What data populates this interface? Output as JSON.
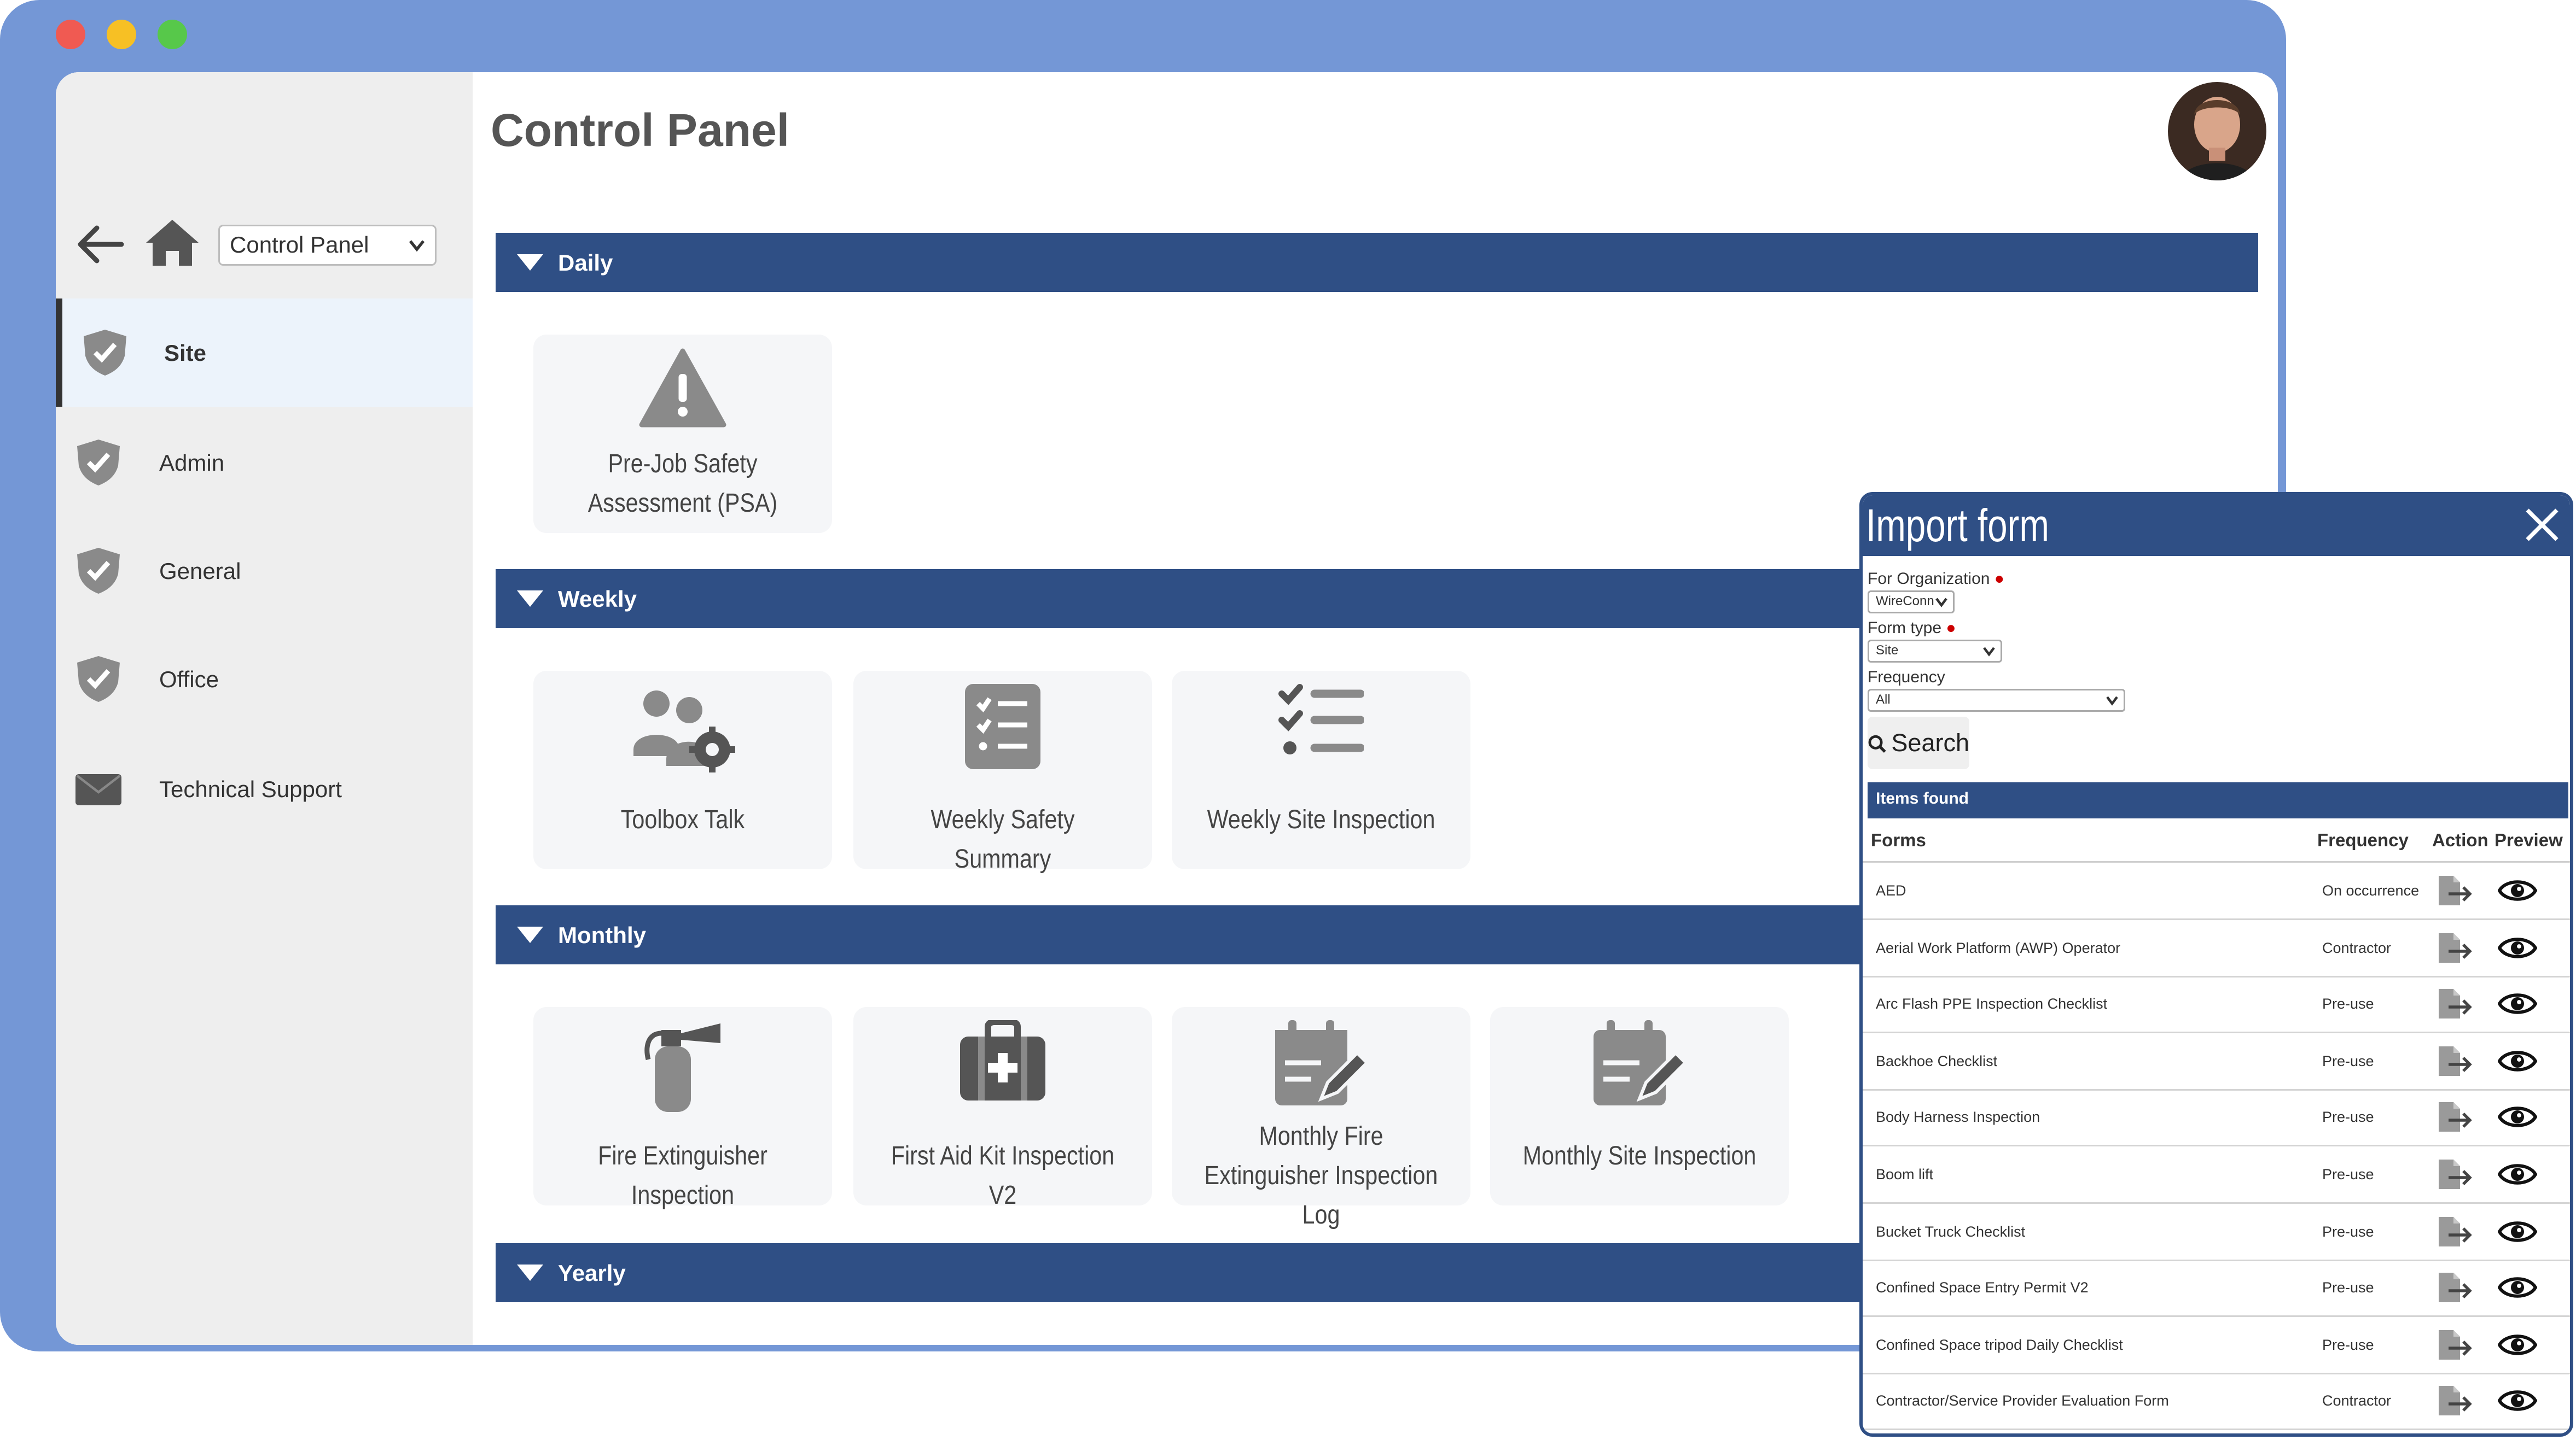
{
  "window": {
    "controls": [
      "close",
      "minimize",
      "maximize"
    ]
  },
  "sidebar": {
    "nav_select": "Control Panel",
    "items": [
      {
        "label": "Site",
        "icon": "shield-check-icon",
        "active": true
      },
      {
        "label": "Admin",
        "icon": "shield-check-icon"
      },
      {
        "label": "General",
        "icon": "shield-check-icon"
      },
      {
        "label": "Office",
        "icon": "shield-check-icon"
      },
      {
        "label": "Technical Support",
        "icon": "envelope-icon"
      }
    ]
  },
  "header": {
    "title": "Control Panel"
  },
  "sections": [
    {
      "label": "Daily",
      "cards": [
        {
          "label": "Pre-Job Safety Assessment (PSA)",
          "icon": "warning-icon"
        }
      ]
    },
    {
      "label": "Weekly",
      "cards": [
        {
          "label": "Toolbox Talk",
          "icon": "users-gear-icon"
        },
        {
          "label": "Weekly Safety Summary",
          "icon": "checklist-clipboard-icon"
        },
        {
          "label": "Weekly Site Inspection",
          "icon": "check-list-icon"
        }
      ]
    },
    {
      "label": "Monthly",
      "cards": [
        {
          "label": "Fire Extinguisher Inspection",
          "icon": "fire-extinguisher-icon"
        },
        {
          "label": "First Aid Kit Inspection V2",
          "icon": "first-aid-kit-icon"
        },
        {
          "label": "Monthly Fire Extinguisher Inspection Log",
          "icon": "calendar-edit-icon"
        },
        {
          "label": "Monthly Site Inspection",
          "icon": "calendar-edit-icon"
        }
      ]
    },
    {
      "label": "Yearly",
      "cards": []
    }
  ],
  "modal": {
    "title": "Import form",
    "org_label": "For Organization",
    "org_value": "WireConn",
    "type_label": "Form type",
    "type_value": "Site",
    "freq_label": "Frequency",
    "freq_value": "All",
    "search_label": "Search",
    "items_found": "Items found",
    "columns": {
      "forms": "Forms",
      "frequency": "Frequency",
      "action": "Action",
      "preview": "Preview"
    },
    "rows": [
      {
        "form": "AED",
        "frequency": "On occurrence"
      },
      {
        "form": "Aerial Work Platform (AWP) Operator",
        "frequency": "Contractor"
      },
      {
        "form": "Arc Flash PPE Inspection Checklist",
        "frequency": "Pre-use"
      },
      {
        "form": "Backhoe Checklist",
        "frequency": "Pre-use"
      },
      {
        "form": "Body Harness Inspection",
        "frequency": "Pre-use"
      },
      {
        "form": "Boom lift",
        "frequency": "Pre-use"
      },
      {
        "form": "Bucket Truck Checklist",
        "frequency": "Pre-use"
      },
      {
        "form": "Confined Space Entry Permit V2",
        "frequency": "Pre-use"
      },
      {
        "form": "Confined Space tripod Daily Checklist",
        "frequency": "Pre-use"
      },
      {
        "form": "Contractor/Service Provider Evaluation Form",
        "frequency": "Contractor"
      }
    ]
  },
  "colors": {
    "window_frame": "#7497d6",
    "section_bar": "#2f4f85",
    "icon_gray": "#8a8a8a"
  }
}
